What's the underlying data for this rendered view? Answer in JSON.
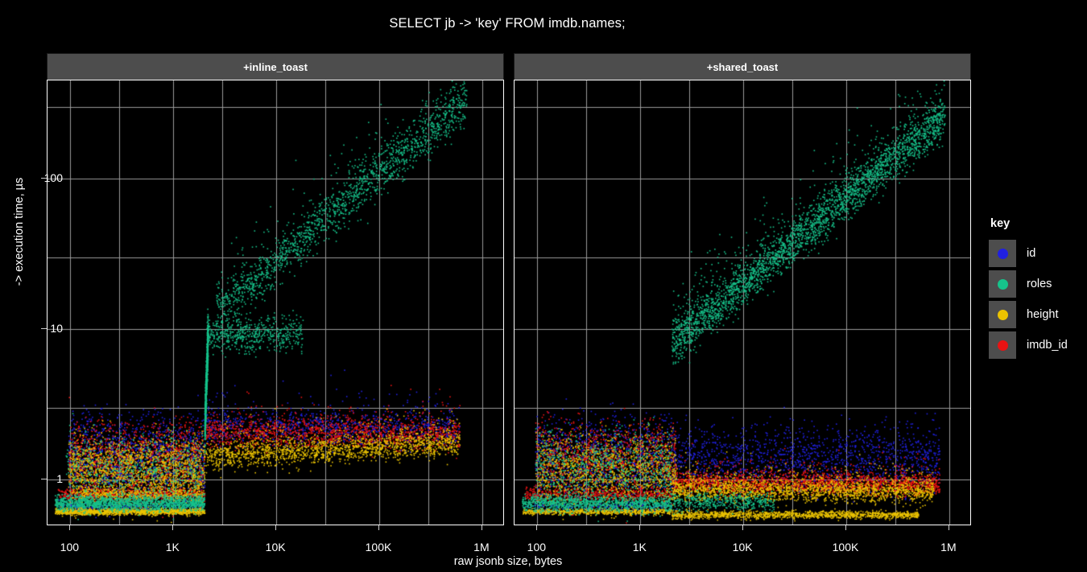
{
  "chart_data": {
    "type": "scatter",
    "title": "SELECT jb -> 'key' FROM imdb.names;",
    "xlabel": "raw jsonb size, bytes",
    "ylabel": "-> execution time, µs",
    "xscale": "log",
    "yscale": "log",
    "xlim": [
      60,
      1600000
    ],
    "ylim": [
      0.5,
      450
    ],
    "xticks": [
      {
        "value": 100,
        "label": "100"
      },
      {
        "value": 1000,
        "label": "1K"
      },
      {
        "value": 10000,
        "label": "10K"
      },
      {
        "value": 100000,
        "label": "100K"
      },
      {
        "value": 1000000,
        "label": "1M"
      }
    ],
    "yticks": [
      {
        "value": 1,
        "label": "1"
      },
      {
        "value": 10,
        "label": "10"
      },
      {
        "value": 100,
        "label": "100"
      }
    ],
    "grid": true,
    "grid_color": "#9a9a9a",
    "background": "#000000",
    "point_size": 1.6,
    "legend": {
      "title": "key",
      "position": "right",
      "entries": [
        {
          "label": "id",
          "color": "#2020e0"
        },
        {
          "label": "roles",
          "color": "#16c38b"
        },
        {
          "label": "height",
          "color": "#ebc300"
        },
        {
          "label": "imdb_id",
          "color": "#e81313"
        }
      ]
    },
    "facets": [
      {
        "label": "+inline_toast",
        "series": [
          {
            "name": "roles",
            "color": "#16c38b",
            "n": 5200,
            "bands": [
              {
                "kind": "flatband",
                "x0": 70,
                "x1": 2000,
                "y": 0.7,
                "spread": 0.045,
                "weight": 0.3
              },
              {
                "kind": "cloud",
                "x0": 90,
                "x1": 2000,
                "y0": 0.8,
                "y1": 1.6,
                "spread": 0.28,
                "weight": 0.12
              },
              {
                "kind": "riser",
                "x0": 2000,
                "x1": 2150,
                "y0": 2.2,
                "y1": 9.5,
                "spread": 0.12,
                "weight": 0.17
              },
              {
                "kind": "flatband",
                "x0": 2100,
                "x1": 18000,
                "y": 9.3,
                "spread": 0.1,
                "weight": 0.1
              },
              {
                "kind": "slope",
                "x0": 2600,
                "x1": 700000,
                "y0": 13.0,
                "y1": 330,
                "spread": 0.13,
                "weight": 0.31
              }
            ]
          },
          {
            "name": "height",
            "color": "#ebc300",
            "n": 5200,
            "bands": [
              {
                "kind": "flatband",
                "x0": 70,
                "x1": 2000,
                "y": 0.615,
                "spread": 0.018,
                "weight": 0.26
              },
              {
                "kind": "cloud",
                "x0": 95,
                "x1": 2000,
                "y0": 0.85,
                "y1": 1.55,
                "spread": 0.24,
                "weight": 0.34
              },
              {
                "kind": "flatband",
                "x0": 105,
                "x1": 2000,
                "y": 0.8,
                "spread": 0.035,
                "weight": 0.08
              },
              {
                "kind": "slope",
                "x0": 2050,
                "x1": 600000,
                "y0": 1.42,
                "y1": 1.75,
                "spread": 0.075,
                "weight": 0.32
              }
            ]
          },
          {
            "name": "imdb_id",
            "color": "#e81313",
            "n": 3400,
            "bands": [
              {
                "kind": "flatband",
                "x0": 75,
                "x1": 2000,
                "y": 0.8,
                "spread": 0.035,
                "weight": 0.22
              },
              {
                "kind": "cloud",
                "x0": 95,
                "x1": 2000,
                "y0": 0.95,
                "y1": 1.9,
                "spread": 0.26,
                "weight": 0.36
              },
              {
                "kind": "slope",
                "x0": 2050,
                "x1": 600000,
                "y0": 2.05,
                "y1": 2.0,
                "spread": 0.085,
                "weight": 0.42
              }
            ]
          },
          {
            "name": "id",
            "color": "#2020e0",
            "n": 2800,
            "bands": [
              {
                "kind": "cloud",
                "x0": 95,
                "x1": 2000,
                "y0": 0.95,
                "y1": 2.1,
                "spread": 0.28,
                "weight": 0.52
              },
              {
                "kind": "flatband",
                "x0": 75,
                "x1": 2000,
                "y": 0.66,
                "spread": 0.03,
                "weight": 0.1
              },
              {
                "kind": "slope",
                "x0": 2050,
                "x1": 600000,
                "y0": 2.2,
                "y1": 2.1,
                "spread": 0.1,
                "weight": 0.38
              }
            ]
          }
        ]
      },
      {
        "label": "+shared_toast",
        "series": [
          {
            "name": "roles",
            "color": "#16c38b",
            "n": 5200,
            "bands": [
              {
                "kind": "flatband",
                "x0": 70,
                "x1": 2000,
                "y": 0.7,
                "spread": 0.045,
                "weight": 0.22
              },
              {
                "kind": "cloud",
                "x0": 95,
                "x1": 2000,
                "y0": 0.85,
                "y1": 1.7,
                "spread": 0.26,
                "weight": 0.14
              },
              {
                "kind": "flatband",
                "x0": 2000,
                "x1": 20000,
                "y": 0.72,
                "spread": 0.05,
                "weight": 0.08
              },
              {
                "kind": "slope",
                "x0": 2000,
                "x1": 900000,
                "y0": 8.0,
                "y1": 260,
                "spread": 0.125,
                "weight": 0.56
              }
            ]
          },
          {
            "name": "height",
            "color": "#ebc300",
            "n": 5200,
            "bands": [
              {
                "kind": "flatband",
                "x0": 70,
                "x1": 2000,
                "y": 0.615,
                "spread": 0.018,
                "weight": 0.13
              },
              {
                "kind": "flatband",
                "x0": 2000,
                "x1": 500000,
                "y": 0.585,
                "spread": 0.022,
                "weight": 0.24
              },
              {
                "kind": "cloud",
                "x0": 95,
                "x1": 2200,
                "y0": 0.85,
                "y1": 1.6,
                "spread": 0.25,
                "weight": 0.26
              },
              {
                "kind": "slope",
                "x0": 2000,
                "x1": 700000,
                "y0": 0.86,
                "y1": 0.83,
                "spread": 0.065,
                "weight": 0.37
              }
            ]
          },
          {
            "name": "imdb_id",
            "color": "#e81313",
            "n": 3600,
            "bands": [
              {
                "kind": "flatband",
                "x0": 75,
                "x1": 2000,
                "y": 0.8,
                "spread": 0.04,
                "weight": 0.16
              },
              {
                "kind": "cloud",
                "x0": 95,
                "x1": 2200,
                "y0": 0.95,
                "y1": 1.9,
                "spread": 0.27,
                "weight": 0.3
              },
              {
                "kind": "slope",
                "x0": 2000,
                "x1": 800000,
                "y0": 0.95,
                "y1": 0.92,
                "spread": 0.06,
                "weight": 0.54
              }
            ]
          },
          {
            "name": "id",
            "color": "#2020e0",
            "n": 2800,
            "bands": [
              {
                "kind": "cloud",
                "x0": 95,
                "x1": 2200,
                "y0": 0.95,
                "y1": 2.1,
                "spread": 0.28,
                "weight": 0.4
              },
              {
                "kind": "flatband",
                "x0": 75,
                "x1": 2000,
                "y": 0.66,
                "spread": 0.03,
                "weight": 0.08
              },
              {
                "kind": "cloud",
                "x0": 2000,
                "x1": 800000,
                "y0": 1.0,
                "y1": 1.9,
                "spread": 0.22,
                "weight": 0.52
              }
            ]
          }
        ]
      }
    ]
  }
}
